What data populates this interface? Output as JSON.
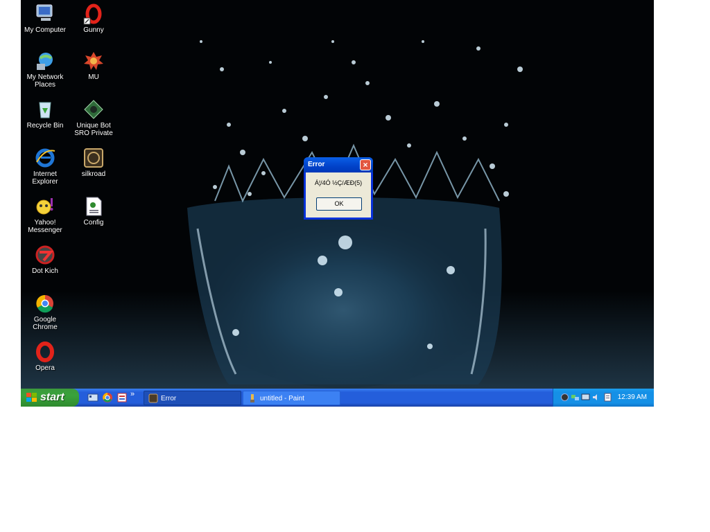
{
  "desktop": {
    "icons": [
      {
        "label": "My Computer",
        "icon": "my-computer-icon"
      },
      {
        "label": "Gunny",
        "icon": "opera-o-icon"
      },
      {
        "label": "My Network Places",
        "icon": "network-places-icon"
      },
      {
        "label": "MU",
        "icon": "mu-game-icon"
      },
      {
        "label": "Recycle Bin",
        "icon": "recycle-bin-icon"
      },
      {
        "label": "Unique Bot SRO Private",
        "icon": "bot-icon"
      },
      {
        "label": "Internet Explorer",
        "icon": "internet-explorer-icon"
      },
      {
        "label": "silkroad",
        "icon": "silkroad-icon"
      },
      {
        "label": "Yahoo! Messenger",
        "icon": "yahoo-messenger-icon"
      },
      {
        "label": "Config",
        "icon": "config-file-icon"
      },
      {
        "label": "Dot Kich",
        "icon": "dot-kich-icon"
      },
      {
        "label": "Google Chrome",
        "icon": "chrome-icon"
      },
      {
        "label": "Opera",
        "icon": "opera-icon"
      }
    ]
  },
  "dialog": {
    "title": "Error",
    "message": "Á¦/4Ó ½Ç/ÆÐ(5)",
    "ok_label": "OK",
    "close_label": "×"
  },
  "taskbar": {
    "start_label": "start",
    "quick_launch": [
      "show-desktop-icon",
      "chrome-icon",
      "app-icon"
    ],
    "chevron": "»",
    "tasks": [
      {
        "label": "Error",
        "active": true
      },
      {
        "label": "untitled - Paint",
        "active": false
      }
    ],
    "clock": "12:39 AM"
  },
  "colors": {
    "taskbar_blue": "#245edb",
    "start_green": "#39a23b",
    "tray_blue": "#1590e6",
    "dialog_face": "#ece9d8",
    "close_red": "#e2563f"
  }
}
